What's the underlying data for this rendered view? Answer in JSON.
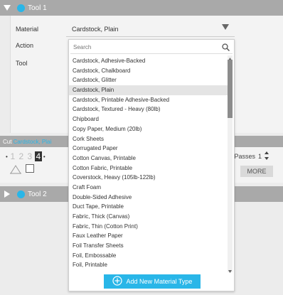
{
  "tool1": {
    "label": "Tool 1"
  },
  "tool2": {
    "label": "Tool 2"
  },
  "material": {
    "label": "Material",
    "value": "Cardstock, Plain"
  },
  "action": {
    "label": "Action"
  },
  "tool": {
    "label": "Tool"
  },
  "search": {
    "placeholder": "Search"
  },
  "materials": [
    "Cardstock, Adhesive-Backed",
    "Cardstock, Chalkboard",
    "Cardstock, Glitter",
    "Cardstock, Plain",
    "Cardstock, Printable Adhesive-Backed",
    "Cardstock, Textured - Heavy (80lb)",
    "Chipboard",
    "Copy Paper, Medium (20lb)",
    "Cork Sheets",
    "Corrugated Paper",
    "Cotton Canvas, Printable",
    "Cotton Fabric, Printable",
    "Coverstock, Heavy (105lb-122lb)",
    "Craft Foam",
    "Double-Sided Adhesive",
    "Duct Tape, Printable",
    "Fabric, Thick (Canvas)",
    "Fabric, Thin (Cotton Print)",
    "Faux Leather Paper",
    "Foil Transfer Sheets",
    "Foil, Embossable",
    "Foil, Printable"
  ],
  "selected_index": 3,
  "add_button": {
    "label": "Add New Material Type"
  },
  "cut": {
    "prefix": "Cut",
    "material": "Cardstock, Plai"
  },
  "numbers": [
    "1",
    "2",
    "3",
    "4"
  ],
  "passes": {
    "label": "Passes",
    "value": "1"
  },
  "more": {
    "label": "MORE"
  },
  "colors": {
    "accent": "#29b6e8",
    "header": "#a9a9a9"
  }
}
